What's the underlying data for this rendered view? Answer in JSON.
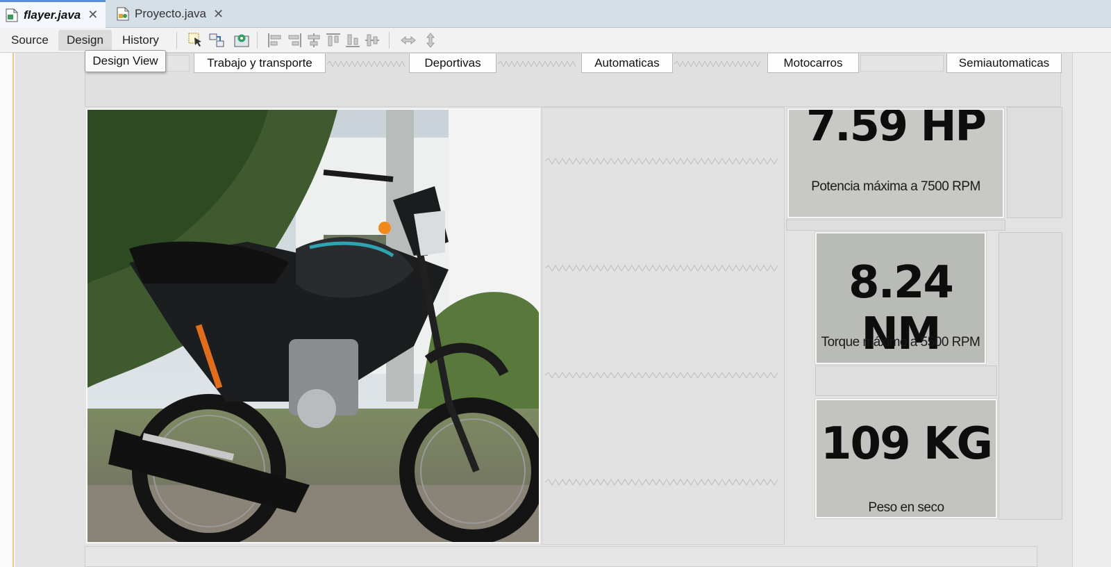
{
  "tabs": [
    {
      "label": "flayer.java",
      "active": true
    },
    {
      "label": "Proyecto.java",
      "active": false
    }
  ],
  "toolbar": {
    "source_label": "Source",
    "design_label": "Design",
    "history_label": "History"
  },
  "tooltip": "Design View",
  "nav": {
    "buttons": [
      "Trabajo y transporte",
      "Deportivas",
      "Automaticas",
      "Motocarros",
      "Semiautomaticas"
    ]
  },
  "specs": [
    {
      "value": "7.59 HP",
      "caption": "Potencia máxima a 7500 RPM"
    },
    {
      "value": "8.24 NM",
      "caption": "Torque máximo a 5500 RPM"
    },
    {
      "value": "109 KG",
      "caption": "Peso en seco"
    }
  ],
  "icons": [
    "java-file-icon",
    "form-file-icon",
    "selection-mode-icon",
    "connection-mode-icon",
    "preview-design-icon",
    "align-left-icon",
    "align-right-icon",
    "center-horizontal-icon",
    "align-top-icon",
    "align-bottom-icon",
    "center-vertical-icon",
    "resize-horizontal-icon",
    "resize-vertical-icon",
    "close-icon"
  ],
  "colors": {
    "tab_accent": "#5b8fd6",
    "gutter_accent": "#f6c38d"
  }
}
